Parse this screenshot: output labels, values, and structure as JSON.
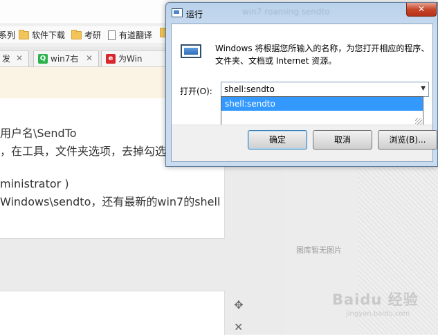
{
  "browser": {
    "bookmarks": [
      {
        "label": "系列",
        "icon": "folder-icon"
      },
      {
        "label": "软件下载",
        "icon": "folder-icon"
      },
      {
        "label": "考研",
        "icon": "folder-icon"
      },
      {
        "label": "有道翻译",
        "icon": "page-icon"
      }
    ],
    "tabs": [
      {
        "label": "发",
        "icon": ""
      },
      {
        "label": "win7右",
        "icon": "Q"
      },
      {
        "label": "为Win",
        "icon": "e"
      }
    ],
    "article_lines": [
      "用户名\\SendTo",
      "，在工具，文件夹选项，去掉勾选",
      "ministrator )",
      "Windows\\sendto，还有最新的win7的shell"
    ],
    "no_image_text": "图库暂无图片",
    "watermark": "Baidu 经验",
    "watermark_sub": "jingyan.baidu.com"
  },
  "dialog": {
    "title": "运行",
    "ghost_title": "win7 roaming sendto",
    "description": "Windows 将根据您所输入的名称，为您打开相应的程序、文件夹、文档或 Internet 资源。",
    "open_label": "打开(O):",
    "input_value": "shell:sendto",
    "dropdown_items": [
      "shell:sendto"
    ],
    "buttons": {
      "ok": "确定",
      "cancel": "取消",
      "browse": "浏览(B)..."
    },
    "close_glyph": "✕"
  }
}
